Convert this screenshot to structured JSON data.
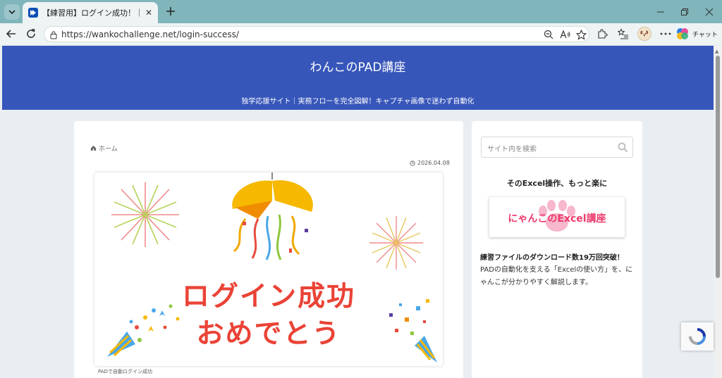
{
  "browser": {
    "tab_title": "【練習用】ログイン成功！｜わんこのPAD講座",
    "url": "https://wankochallenge.net/login-success/",
    "chat_label": "チャット"
  },
  "site": {
    "title": "わんこのPAD講座",
    "tagline": "独学応援サイト｜実務フローを完全図解！キャプチャ画像で迷わず自動化",
    "accent_color": "#3756ba"
  },
  "article": {
    "breadcrumb_home": "ホーム",
    "date": "2026.04.08",
    "image_line1": "ログイン成功",
    "image_line2": "おめでとう",
    "caption": "PADで自動ログイン成功"
  },
  "sidebar": {
    "search_placeholder": "サイト内を検索",
    "promo_title": "そのExcel操作、もっと楽に",
    "banner_text": "にゃんこのExcel講座",
    "promo_lead": "練習ファイルのダウンロード数19万回突破！",
    "promo_desc": "PADの自動化を支える「Excelの使い方」を、にゃんこが分かりやすく解説します。"
  }
}
